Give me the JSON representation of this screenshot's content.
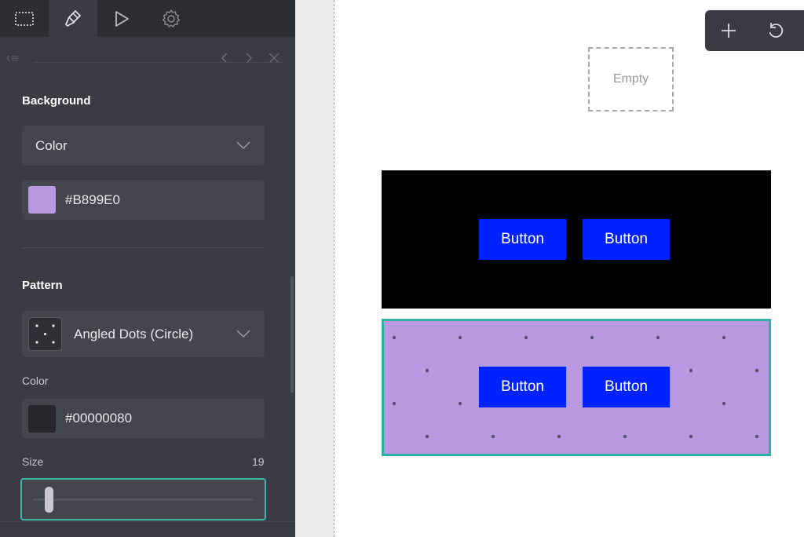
{
  "colors": {
    "panel_bg": "#3b3b43",
    "accent": "#3cb8a8",
    "button_blue": "#0022ff",
    "swatch_background": "#B899E0",
    "swatch_pattern": "#00000080"
  },
  "toolbar": {
    "tabs": [
      {
        "icon": "select-icon"
      },
      {
        "icon": "brush-icon"
      },
      {
        "icon": "play-icon"
      },
      {
        "icon": "gear-icon"
      }
    ]
  },
  "panel": {
    "background": {
      "title": "Background",
      "type_select": "Color",
      "color_value": "#B899E0"
    },
    "pattern": {
      "title": "Pattern",
      "select_value": "Angled Dots (Circle)",
      "color_label": "Color",
      "color_value": "#00000080",
      "size_label": "Size",
      "size_value": "19"
    }
  },
  "canvas": {
    "empty_label": "Empty",
    "black_block": {
      "buttons": [
        "Button",
        "Button"
      ]
    },
    "purple_block": {
      "buttons": [
        "Button",
        "Button"
      ]
    }
  },
  "floating_toolbar": {
    "icons": [
      "plus-icon",
      "undo-icon"
    ]
  }
}
